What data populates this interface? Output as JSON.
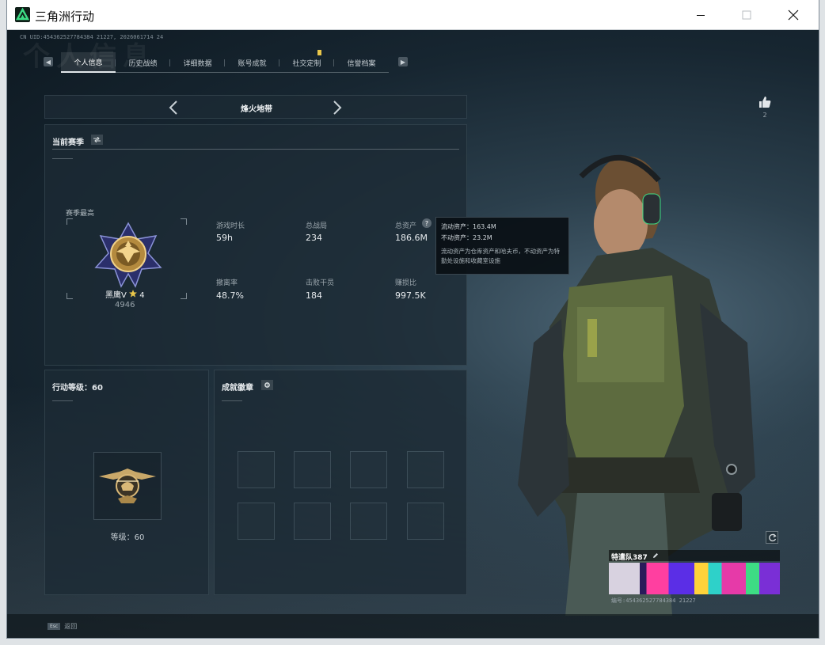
{
  "window": {
    "title": "三角洲行动"
  },
  "header": {
    "uid": "CN UID:454362527784384 21227, 2026061714 24",
    "ghost_title": "个人信息"
  },
  "tabs": [
    {
      "label": "个人信息",
      "active": true
    },
    {
      "label": "历史战绩"
    },
    {
      "label": "详细数据"
    },
    {
      "label": "账号成就"
    },
    {
      "label": "社交定制"
    },
    {
      "label": "信誉档案"
    }
  ],
  "mode_selector": {
    "label": "烽火地带"
  },
  "like": {
    "count": "2"
  },
  "season": {
    "title": "当前赛季",
    "best_label": "赛季最高",
    "rank_name": "黑鹰V",
    "rank_stars": "4",
    "rank_score": "4946",
    "stats": [
      {
        "label": "游戏时长",
        "value": "59h"
      },
      {
        "label": "总战局",
        "value": "234"
      },
      {
        "label": "总资产",
        "value": "186.6M"
      },
      {
        "label": "撤离率",
        "value": "48.7%"
      },
      {
        "label": "击败干员",
        "value": "184"
      },
      {
        "label": "赚损比",
        "value": "997.5K"
      }
    ],
    "help_glyph": "?"
  },
  "tooltip": {
    "liquid": "流动资产：163.4M",
    "fixed": "不动资产：23.2M",
    "desc": "流动资产为仓库资产和哈夫币，不动资产为特勤处设施和收藏室设施"
  },
  "level": {
    "title": "行动等级：60",
    "label": "等级：60"
  },
  "badges": {
    "title": "成就徽章"
  },
  "squad_card": {
    "name": "特遣队387",
    "id": "编号:454362527784384 21227"
  },
  "bottom": {
    "key": "Esc",
    "label": "返回"
  },
  "colors": {
    "accent_green": "#3ddc84",
    "gold": "#e9c74a",
    "panel": "#1c2a34"
  }
}
